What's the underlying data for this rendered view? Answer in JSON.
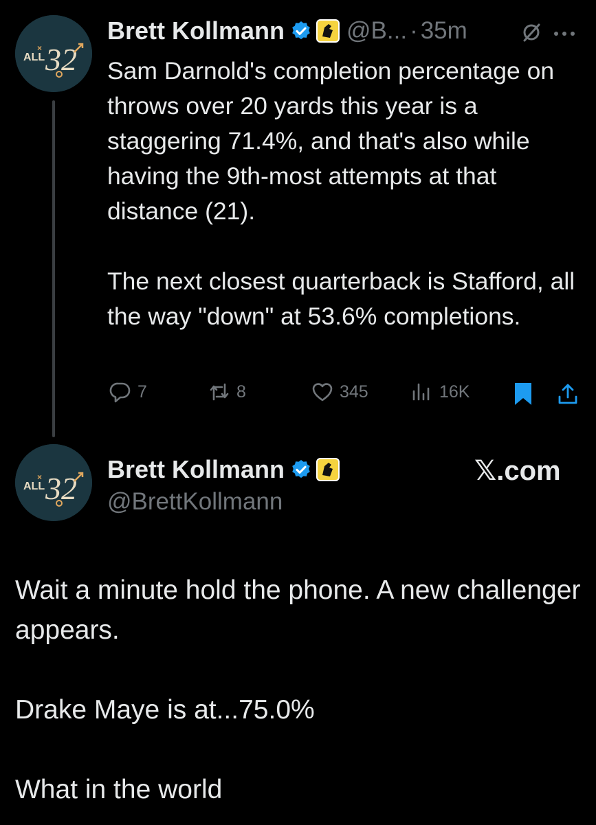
{
  "tweet": {
    "author_name": "Brett Kollmann",
    "handle_truncated": "@B...",
    "separator": "·",
    "time": "35m",
    "avatar_text": "ALL32",
    "paragraphs": [
      "Sam Darnold's completion percentage on throws over 20 yards this year is a staggering 71.4%, and that's also while having the 9th-most attempts at that distance (21).",
      "The next closest quarterback is Stafford, all the way \"down\" at 53.6% completions."
    ],
    "actions": {
      "replies": "7",
      "reposts": "8",
      "likes": "345",
      "views": "16K"
    },
    "icons": [
      "verified-badge-icon",
      "affiliate-badge-icon",
      "grok-icon",
      "more-icon",
      "reply-icon",
      "repost-icon",
      "like-icon",
      "views-icon",
      "bookmark-icon",
      "share-icon"
    ],
    "accent_color": "#1d9bf0"
  },
  "quote": {
    "author_name": "Brett Kollmann",
    "handle": "@BrettKollmann",
    "source_label": "𝕏.com",
    "paragraphs": [
      "Wait a minute hold the phone. A new challenger appears.",
      "Drake Maye is at...75.0%",
      "What in the world"
    ]
  }
}
